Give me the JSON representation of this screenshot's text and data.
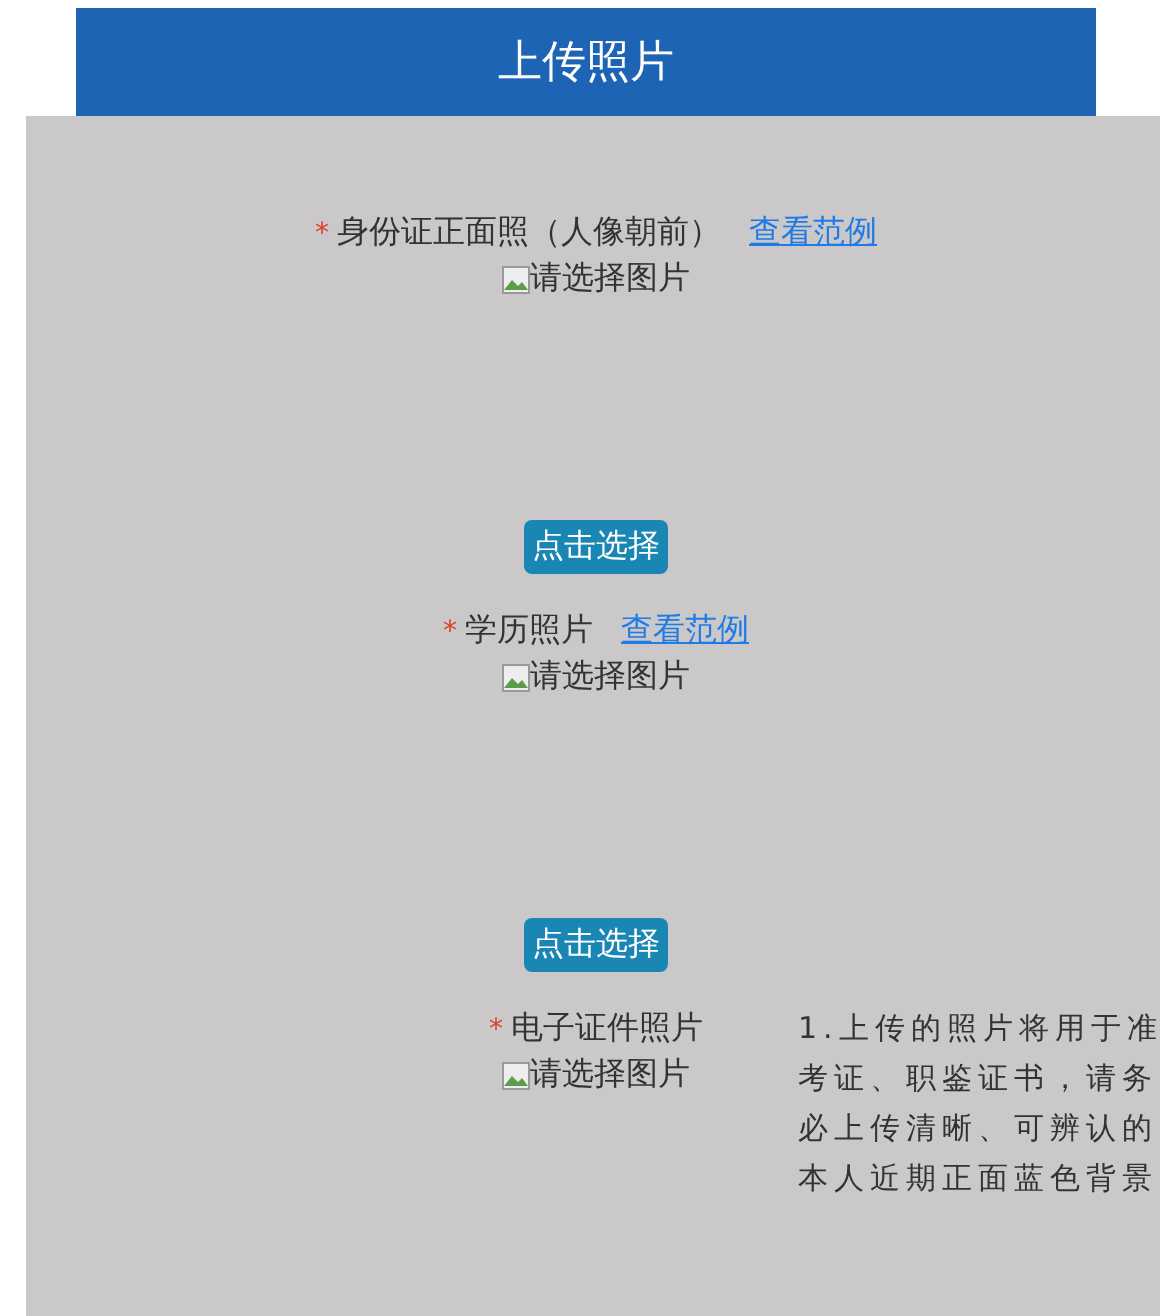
{
  "header": {
    "title": "上传照片"
  },
  "sections": [
    {
      "required_mark": "*",
      "label": "身份证正面照（人像朝前）",
      "example_link": "查看范例",
      "alt_text": "请选择图片",
      "button": "点击选择"
    },
    {
      "required_mark": "*",
      "label": "学历照片",
      "example_link": "查看范例",
      "alt_text": "请选择图片",
      "button": "点击选择"
    },
    {
      "required_mark": "*",
      "label": "电子证件照片",
      "alt_text": "请选择图片",
      "note": "1.上传的照片将用于准考证、职鉴证书，请务必上传清晰、可辨认的本人近期正面蓝色背景"
    }
  ]
}
